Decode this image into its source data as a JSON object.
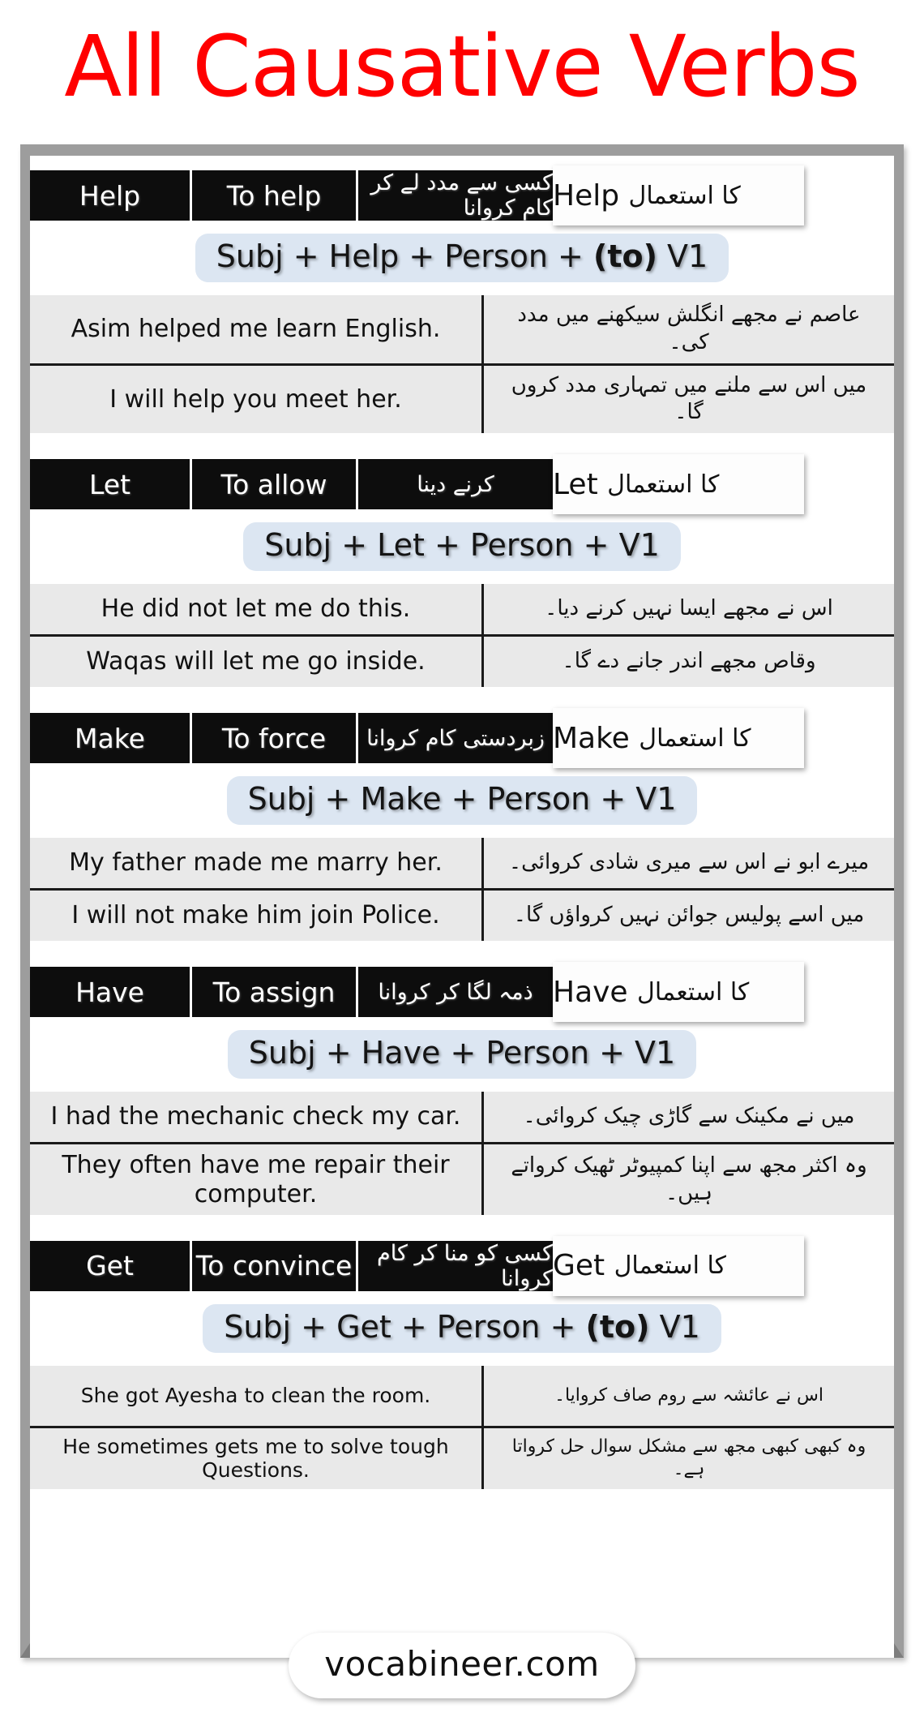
{
  "poster": {
    "title": "All Causative Verbs",
    "title_color": "#ff0000",
    "accent_formula_bg": "#dce6f2",
    "header_bg": "#0d0d0d",
    "row_bg": "#e9e9e9",
    "frame_border_color": "#9d9d9d"
  },
  "sections": [
    {
      "verb": "Help",
      "meaning_en": "To help",
      "meaning_ur": "کسی سے مدد لے کر کام کروانا",
      "label_en": "Help",
      "label_ur": "کا استعمال",
      "formula_pre": "Subj + Help + Person + ",
      "formula_bold": "(to)",
      "formula_post": " V1",
      "examples": [
        {
          "en": "Asim helped me learn English.",
          "ur": "عاصم نے مجھے انگلش سیکھنے میں مدد کی۔"
        },
        {
          "en": "I will help you meet her.",
          "ur": "میں اس سے ملنے میں تمہاری مدد کروں گا۔"
        }
      ]
    },
    {
      "verb": "Let",
      "meaning_en": "To allow",
      "meaning_ur": "کرنے دینا",
      "label_en": "Let",
      "label_ur": "کا استعمال",
      "formula_pre": "Subj + Let + Person + V1",
      "formula_bold": "",
      "formula_post": "",
      "examples": [
        {
          "en": "He did not let me do this.",
          "ur": "اس نے مجھے ایسا نہیں کرنے دیا۔"
        },
        {
          "en": "Waqas will let me go inside.",
          "ur": "وقاص مجھے اندر جانے دے گا۔"
        }
      ]
    },
    {
      "verb": "Make",
      "meaning_en": "To force",
      "meaning_ur": "زبردستی کام کروانا",
      "label_en": "Make",
      "label_ur": "کا استعمال",
      "formula_pre": "Subj + Make + Person + V1",
      "formula_bold": "",
      "formula_post": "",
      "examples": [
        {
          "en": "My father made me marry her.",
          "ur": "میرے ابو نے اس سے میری شادی کروائی۔"
        },
        {
          "en": "I will not make him join Police.",
          "ur": "میں اسے پولیس جوائن نہیں کرواؤں گا۔"
        }
      ]
    },
    {
      "verb": "Have",
      "meaning_en": "To assign",
      "meaning_ur": "ذمہ لگا کر کروانا",
      "label_en": "Have",
      "label_ur": "کا استعمال",
      "formula_pre": "Subj + Have + Person + V1",
      "formula_bold": "",
      "formula_post": "",
      "examples": [
        {
          "en": "I had the mechanic check my car.",
          "ur": "میں نے مکینک سے گاڑی چیک کروائی۔"
        },
        {
          "en": "They often have me repair their computer.",
          "ur": "وہ اکثر مجھ سے اپنا کمپیوٹر ٹھیک کرواتے ہیں۔"
        }
      ]
    },
    {
      "verb": "Get",
      "meaning_en": "To convince",
      "meaning_ur": "کسی کو منا کر کام کروانا",
      "label_en": "Get",
      "label_ur": "کا استعمال",
      "formula_pre": "Subj + Get + Person + ",
      "formula_bold": "(to)",
      "formula_post": " V1",
      "examples": [
        {
          "en": "She got Ayesha to clean the room.",
          "ur": "اس نے عائشہ سے روم صاف کروایا۔"
        },
        {
          "en": "He sometimes gets me to solve tough Questions.",
          "ur": "وہ کبھی کبھی مجھ سے مشکل سوال حل کرواتا ہے۔"
        }
      ]
    }
  ],
  "footer": {
    "brand": "vocabineer.com"
  }
}
